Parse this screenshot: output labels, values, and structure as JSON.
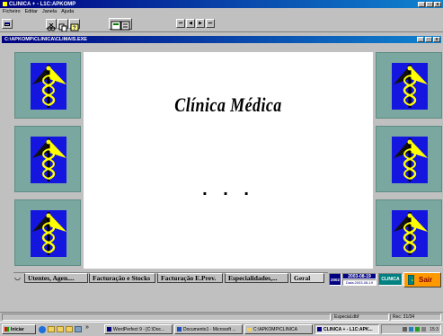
{
  "app_title": "CLINICA + - L1C:APKOMP",
  "menu": [
    "Ficheiro",
    "Editar",
    "Janela",
    "Ajuda"
  ],
  "child_title": "C:\\APKOMP\\CLINICA\\CLIMAIS.EXE",
  "nav_buttons": [
    "⏮",
    "◀",
    "▶",
    "⏭"
  ],
  "main": {
    "heading": "Clínica Médica",
    "dots": ". . ."
  },
  "tabs": [
    "Utentes, Agen....",
    "Facturação e Stocks",
    "Facturação E.Prev.",
    "Especialidades,...",
    "Geral"
  ],
  "status": {
    "year": "2002",
    "date": "2003-08-19",
    "subdate": "Data:2003-08-19",
    "clinic": "CLINICA",
    "exit_label": "Sair"
  },
  "status_bar": {
    "file": "Especial.dbf",
    "rec": "Rec: 31/34"
  },
  "taskbar": {
    "start": "Iniciar",
    "items": [
      "WordPerfect 9 - [C:\\Doc...",
      "Documento1 - Microsoft ...",
      "C:\\APKOMP\\CLINICA",
      "CLINICA + - L1C:APK..."
    ],
    "clock": "15:3"
  },
  "colors": {
    "title_bar": "#000080",
    "tile_bg": "#7aa8a0",
    "emblem_blue": "#1515e0",
    "emblem_yellow": "#ffff00",
    "exit_button": "#ff9900"
  }
}
